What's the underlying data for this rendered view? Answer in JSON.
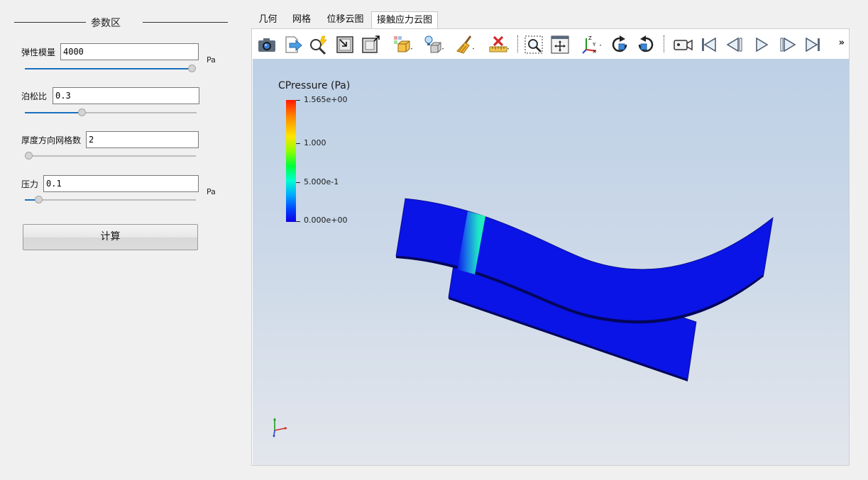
{
  "panel": {
    "title": "参数区",
    "elastic_modulus": {
      "label": "弹性模量",
      "value": "4000",
      "unit": "Pa",
      "slider_fraction": 0.98
    },
    "poisson_ratio": {
      "label": "泊松比",
      "value": "0.3",
      "slider_fraction": 0.33
    },
    "thickness_mesh": {
      "label": "厚度方向网格数",
      "value": "2",
      "slider_fraction": 0.0
    },
    "pressure": {
      "label": "压力",
      "value": "0.1",
      "unit": "Pa",
      "slider_fraction": 0.08
    },
    "compute_button": "计算"
  },
  "tabs": [
    {
      "label": "几何",
      "active": false
    },
    {
      "label": "网格",
      "active": false
    },
    {
      "label": "位移云图",
      "active": false
    },
    {
      "label": "接触应力云图",
      "active": true
    }
  ],
  "toolbar": {
    "icons": [
      "camera-icon",
      "export-icon",
      "probe-query-icon",
      "zoom-box-icon",
      "zoom-out-box-icon",
      "surface-representation-icon",
      "lighting-icon",
      "clear-brush-icon",
      "ruler-delete-icon",
      "zoom-to-data-icon",
      "reset-view-icon",
      "axes-orientation-icon",
      "rotate-cw-icon",
      "rotate-ccw-icon",
      "video-camera-icon",
      "first-frame-icon",
      "previous-frame-icon",
      "play-icon",
      "next-frame-icon",
      "last-frame-icon"
    ],
    "more": "»"
  },
  "viewport": {
    "legend": {
      "title": "CPressure (Pa)",
      "ticks": [
        "1.565e+00",
        "1.000",
        "5.000e-1",
        "0.000e+00"
      ],
      "range": [
        0,
        1.565
      ]
    },
    "colors": {
      "mesh_blue": "#0a14e6",
      "contact_cyan": "#1ee6c8",
      "background_top": "#bdd0e6",
      "background_bottom": "#e3e6ec"
    }
  }
}
